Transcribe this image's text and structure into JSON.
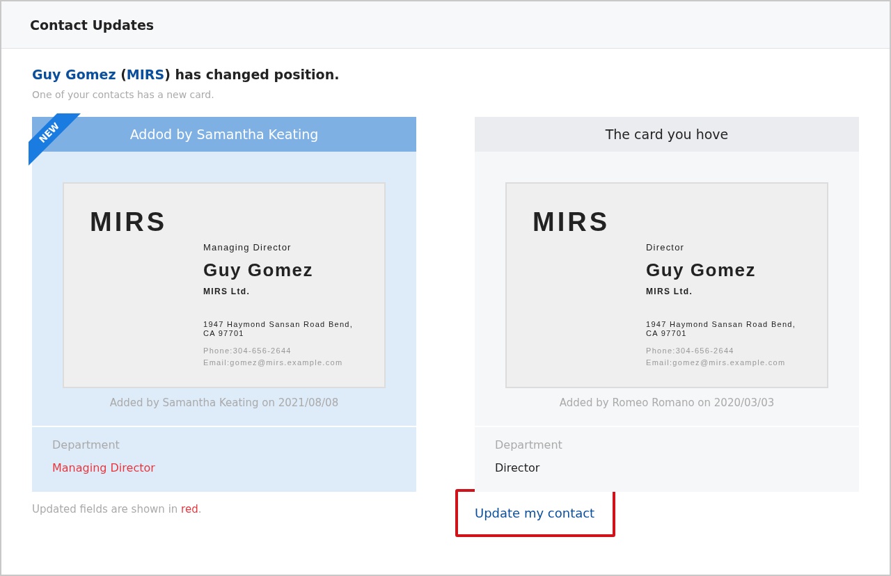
{
  "page": {
    "title": "Contact Updates"
  },
  "headline": [
    {
      "kind": "link",
      "text": "Guy Gomez"
    },
    {
      "kind": "plain",
      "text": " ("
    },
    {
      "kind": "link",
      "text": "MIRS"
    },
    {
      "kind": "plain",
      "text": ") has changed position."
    }
  ],
  "subtitle": "One of your contacts has a new card.",
  "cards": [
    {
      "header": "Addod by Samantha Keating",
      "is_new": true,
      "badge": "NEW",
      "logo": "MIRS",
      "title": "Managing Director",
      "name": "Guy Gomez",
      "company": "MIRS Ltd.",
      "address": "1947 Haymond Sansan Road Bend,\nCA 97701",
      "phone": "Phone:304-656-2644",
      "email": "Email:gomez@mirs.example.com",
      "added_by": "Added by Samantha Keating on 2021/08/08",
      "field_label": "Department",
      "field_value": "Managing Director",
      "changed": true
    },
    {
      "header": "The card you hove",
      "is_new": false,
      "logo": "MIRS",
      "title": "Director",
      "name": "Guy Gomez",
      "company": "MIRS Ltd.",
      "address": "1947 Haymond Sansan Road Bend,\nCA 97701",
      "phone": "Phone:304-656-2644",
      "email": "Email:gomez@mirs.example.com",
      "added_by": "Added by Romeo Romano on 2020/03/03",
      "field_label": "Department",
      "field_value": "Director",
      "changed": false
    }
  ],
  "note": {
    "before": "Updated fields are shown in ",
    "highlight": "red",
    "after": "."
  },
  "action": {
    "label": "Update my contact",
    "highlighted": true
  }
}
